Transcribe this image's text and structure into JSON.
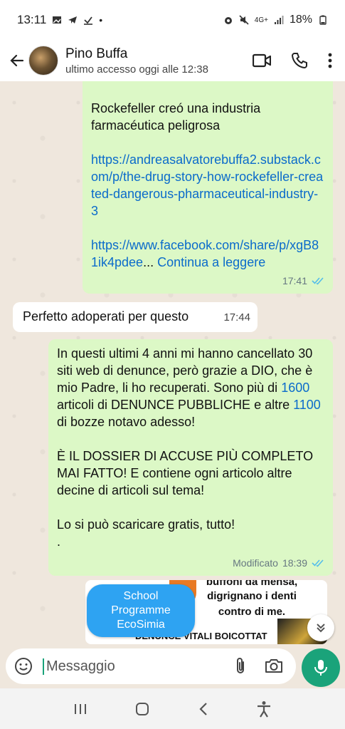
{
  "status_bar": {
    "time": "13:11",
    "battery": "18%",
    "network": "4G+"
  },
  "header": {
    "name": "Pino Buffa",
    "last_seen": "ultimo accesso oggi alle 12:38"
  },
  "messages": [
    {
      "text_title": "Rockefeller creó una industria farmacéutica peligrosa",
      "link1": "https://andreasalvatorebuffa2.substack.com/p/the-drug-story-how-rockefeller-created-dangerous-pharmaceutical-industry-3",
      "link2_part": "https://www.facebook.com/share/p/xgB81ik4pdee",
      "ellipsis": "... ",
      "continue": "Continua a leggere",
      "time": "17:41"
    },
    {
      "text": "Perfetto adoperati per questo",
      "time": "17:44"
    },
    {
      "p1_a": "In questi ultimi 4 anni mi hanno cancellato 30 siti web di denunce, però grazie  a DIO, che è mio Padre, li ho recuperati. Sono più di ",
      "n1": "1600",
      "p1_b": " articoli di DENUNCE PUBBLICHE e altre ",
      "n2": "1100",
      "p1_c": " di bozze notavo adesso!",
      "p2": "È IL DOSSIER DI ACCUSE PIÙ COMPLETO MAI FATTO! E contiene ogni articolo altre decine di articoli sul tema!",
      "p3": "Lo si può scaricare gratis, tutto!",
      "p4": ".",
      "edited_label": "Modificato",
      "time": "18:39"
    }
  ],
  "preview": {
    "line1": "buffoni da mensa,",
    "line2": "digrignano i denti",
    "line3": "contro di me.",
    "bottom": "DENUNCE VITALI BOICOTTAT"
  },
  "school_button": {
    "line1": "School",
    "line2": "Programme",
    "line3": "EcoSimia"
  },
  "composer": {
    "placeholder": "Messaggio"
  },
  "colors": {
    "outgoing": "#dcf8c6",
    "incoming": "#ffffff",
    "accent": "#1aa37a",
    "link": "#0b6bcb",
    "read_ticks": "#53bdeb"
  }
}
